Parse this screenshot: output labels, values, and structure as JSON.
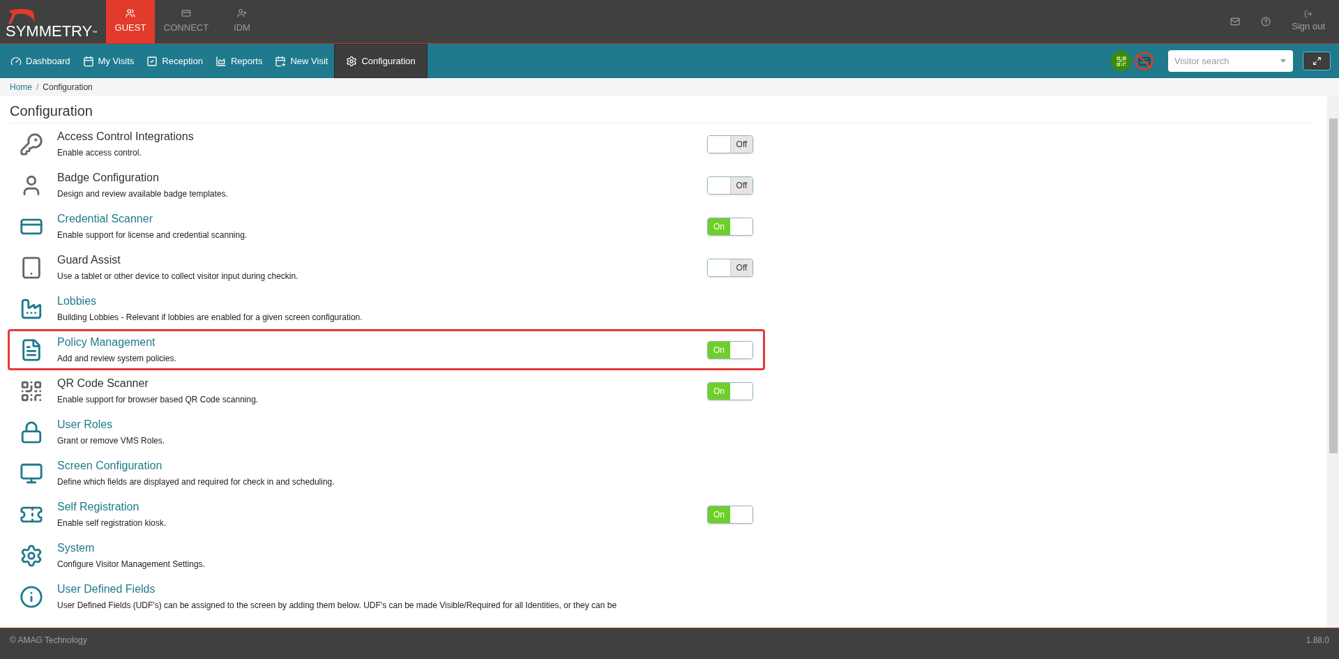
{
  "brand": {
    "name": "SYMMETRY",
    "mark": "™"
  },
  "apps": [
    {
      "label": "GUEST",
      "selected": true
    },
    {
      "label": "CONNECT",
      "selected": false
    },
    {
      "label": "IDM",
      "selected": false
    }
  ],
  "top_actions": {
    "sign_out": "Sign out"
  },
  "nav": [
    {
      "label": "Dashboard",
      "selected": false
    },
    {
      "label": "My Visits",
      "selected": false
    },
    {
      "label": "Reception",
      "selected": false
    },
    {
      "label": "Reports",
      "selected": false
    },
    {
      "label": "New Visit",
      "selected": false
    },
    {
      "label": "Configuration",
      "selected": true
    }
  ],
  "visitor_search": {
    "placeholder": "Visitor search"
  },
  "breadcrumb": {
    "items": [
      "Home",
      "Configuration"
    ],
    "separator": "/"
  },
  "page_title": "Configuration",
  "items": [
    {
      "title": "Access Control Integrations",
      "description": "Enable access control.",
      "link": false,
      "toggle": {
        "on": false,
        "label": "Off"
      },
      "highlighted": false
    },
    {
      "title": "Badge Configuration",
      "description": "Design and review available badge templates.",
      "link": false,
      "toggle": {
        "on": false,
        "label": "Off"
      },
      "highlighted": false
    },
    {
      "title": "Credential Scanner",
      "description": "Enable support for license and credential scanning.",
      "link": true,
      "toggle": {
        "on": true,
        "label": "On"
      },
      "highlighted": false
    },
    {
      "title": "Guard Assist",
      "description": "Use a tablet or other device to collect visitor input during checkin.",
      "link": false,
      "toggle": {
        "on": false,
        "label": "Off"
      },
      "highlighted": false
    },
    {
      "title": "Lobbies",
      "description": "Building Lobbies - Relevant if lobbies are enabled for a given screen configuration.",
      "link": true,
      "highlighted": false
    },
    {
      "title": "Policy Management",
      "description": "Add and review system policies.",
      "link": true,
      "toggle": {
        "on": true,
        "label": "On"
      },
      "highlighted": true
    },
    {
      "title": "QR Code Scanner",
      "description": "Enable support for browser based QR Code scanning.",
      "link": false,
      "toggle": {
        "on": true,
        "label": "On"
      },
      "highlighted": false
    },
    {
      "title": "User Roles",
      "description": "Grant or remove VMS Roles.",
      "link": true,
      "highlighted": false
    },
    {
      "title": "Screen Configuration",
      "description": "Define which fields are displayed and required for check in and scheduling.",
      "link": true,
      "highlighted": false
    },
    {
      "title": "Self Registration",
      "description": "Enable self registration kiosk.",
      "link": true,
      "toggle": {
        "on": true,
        "label": "On"
      },
      "highlighted": false
    },
    {
      "title": "System",
      "description": "Configure Visitor Management Settings.",
      "link": true,
      "highlighted": false
    },
    {
      "title": "User Defined Fields",
      "description": "User Defined Fields (UDF's) can be assigned to the screen by adding them below. UDF's can be made Visible/Required for all Identities, or they can be",
      "link": true,
      "highlighted": false
    }
  ],
  "footer": {
    "copyright": "© AMAG Technology",
    "version": "1.88.0"
  }
}
